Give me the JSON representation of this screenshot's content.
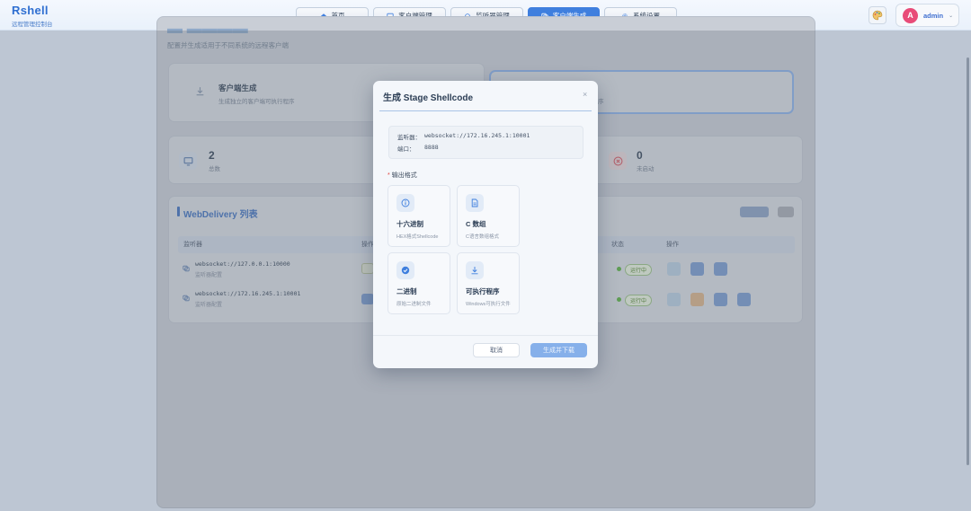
{
  "app": {
    "title": "Rshell",
    "subtitle": "远程管理控制台"
  },
  "nav": [
    {
      "label": "首页",
      "icon": "home-icon",
      "active": false
    },
    {
      "label": "客户端管理",
      "icon": "monitor-icon",
      "active": false
    },
    {
      "label": "监听器管理",
      "icon": "headset-icon",
      "active": false
    },
    {
      "label": "客户端生成",
      "icon": "layers-icon",
      "active": true
    },
    {
      "label": "系统设置",
      "icon": "gear-icon",
      "active": false
    }
  ],
  "user": {
    "initial": "A",
    "name": "admin"
  },
  "page": {
    "description": "配置并生成适用于不同系统的远程客户端"
  },
  "gen_cards": [
    {
      "title": "客户端生成",
      "desc": "生成独立的客户端可执行程序"
    },
    {
      "title": "",
      "desc": "序"
    }
  ],
  "stats": [
    {
      "value": "2",
      "label": "总数"
    },
    {
      "value": "0",
      "label": "未启动"
    }
  ],
  "webdelivery": {
    "title": "WebDelivery 列表",
    "columns": [
      "监听器",
      "操作",
      "状态",
      "操作"
    ],
    "rows": [
      {
        "listener": "websocket://127.0.0.1:10000",
        "sub": "监听器配置",
        "status": "运行中"
      },
      {
        "listener": "websocket://172.16.245.1:10001",
        "sub": "监听器配置",
        "status": "运行中"
      }
    ]
  },
  "modal": {
    "title": "生成 Stage Shellcode",
    "close": "×",
    "listener_key": "监听器：",
    "listener_value": "websocket://172.16.245.1:10001",
    "port_key": "端口：",
    "port_value": "8888",
    "format_label": "输出格式",
    "required_mark": "*",
    "options": [
      {
        "name": "十六进制",
        "desc": "HEX格式Shellcode",
        "icon": "info-icon"
      },
      {
        "name": "C 数组",
        "desc": "C语言数组格式",
        "icon": "file-icon"
      },
      {
        "name": "二进制",
        "desc": "原始二进制文件",
        "icon": "check-circle-icon"
      },
      {
        "name": "可执行程序",
        "desc": "Windows可执行文件",
        "icon": "download-icon"
      }
    ],
    "cancel": "取消",
    "confirm": "生成并下载"
  }
}
